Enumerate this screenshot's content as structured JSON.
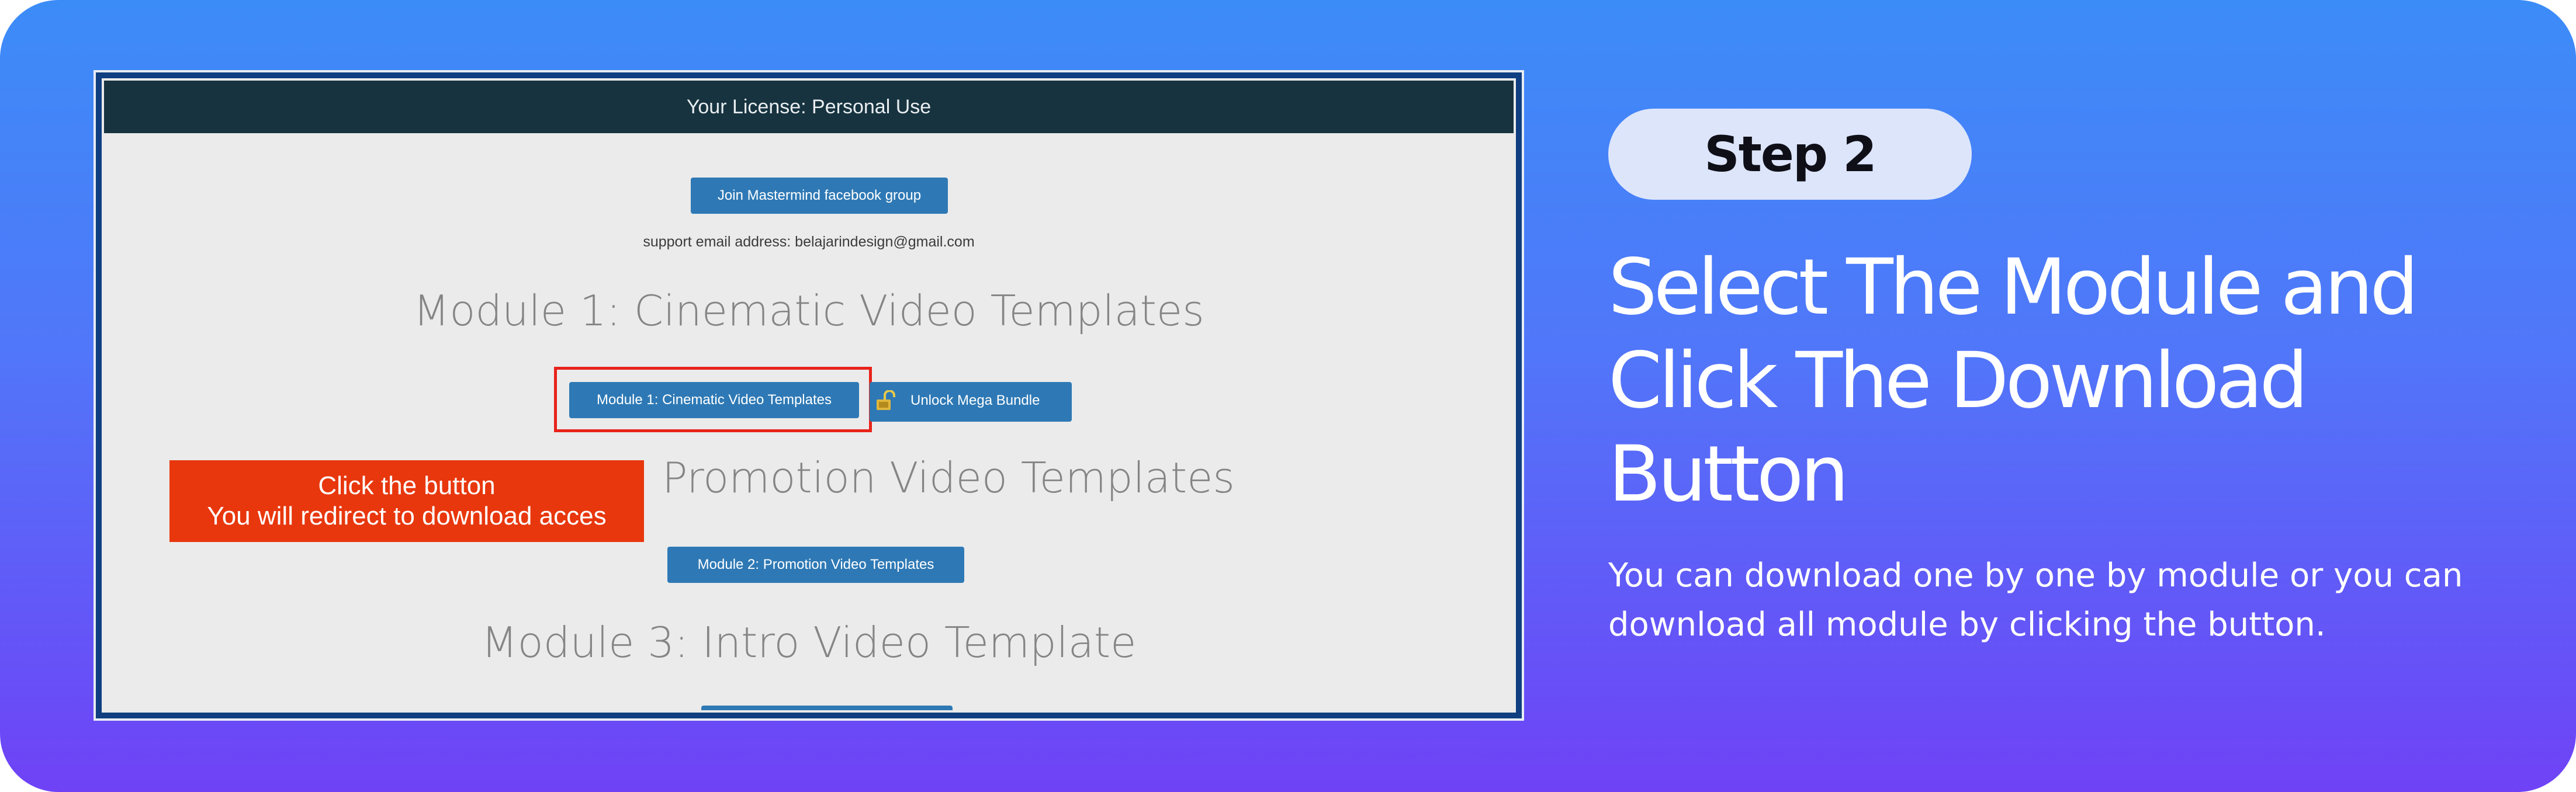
{
  "screenshot": {
    "license_bar": "Your License: Personal Use",
    "join_button": "Join Mastermind facebook group",
    "support_text": "support email address: belajarindesign@gmail.com",
    "module1_title": "Module 1: Cinematic Video Templates",
    "module1_button": "Module 1: Cinematic Video Templates",
    "unlock_button": "Unlock Mega Bundle",
    "module2_title": "Promotion Video Templates",
    "module2_button": "Module 2: Promotion Video Templates",
    "module3_title": "Module 3: Intro Video Template",
    "callout_line1": "Click the button",
    "callout_line2": "You will redirect to download acces"
  },
  "step_label": "Step 2",
  "headline": "Select The Module and Click The Download Button",
  "description": "You can download one by one by module or you can download all module by clicking the button.",
  "colors": {
    "gradient_top": "#3c8cf8",
    "gradient_bottom": "#6f42f6",
    "callout": "#e8370d",
    "highlight": "#e8231a",
    "button_blue": "#2e79b5",
    "license_bar": "#173340",
    "step_pill": "#dde5fb"
  },
  "icons": {
    "unlock": "unlock-icon",
    "arrow": "arrow-icon"
  }
}
